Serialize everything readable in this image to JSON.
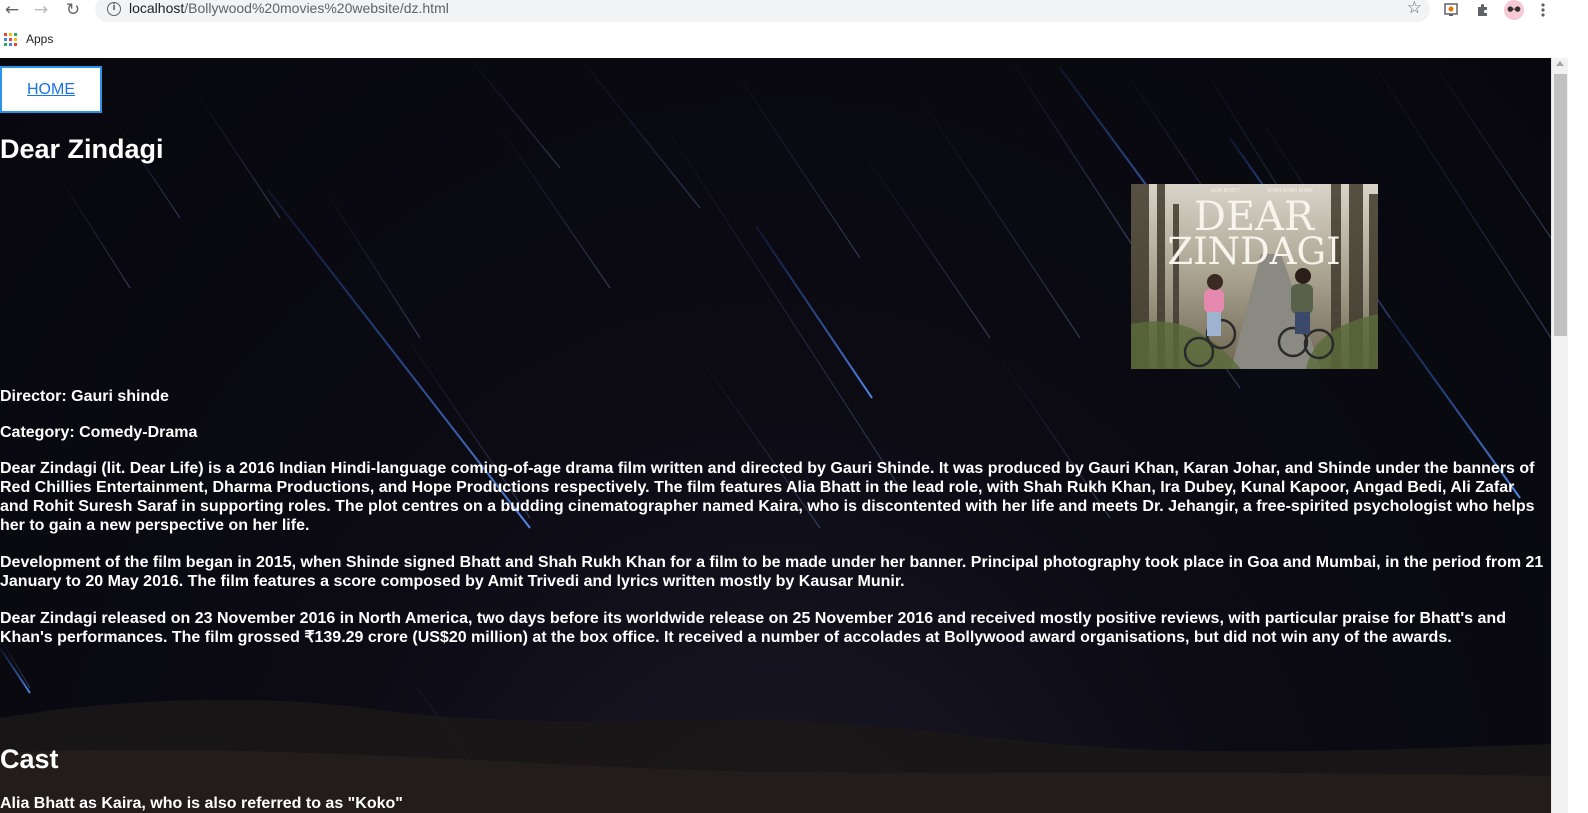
{
  "browser": {
    "url_host": "localhost",
    "url_path": "/Bollywood%20movies%20website/dz.html",
    "bookmarks_apps_label": "Apps",
    "icons": [
      "back-arrow-icon",
      "forward-arrow-icon",
      "reload-icon",
      "info-icon",
      "star-icon",
      "extension-icon",
      "puzzle-icon",
      "profile-avatar-icon",
      "menu-icon",
      "apps-grid-icon"
    ]
  },
  "nav": {
    "home_label": "HOME"
  },
  "movie": {
    "title": "Dear Zindagi",
    "poster": {
      "credit_left": "ALIA BHATT",
      "credit_right": "SHAH RUKH KHAN",
      "title_line1": "DEAR",
      "title_line2": "ZINDAGI"
    },
    "director": "Director: Gauri shinde",
    "category": "Category: Comedy-Drama",
    "paragraphs": [
      "Dear Zindagi (lit. Dear Life) is a 2016 Indian Hindi-language coming-of-age drama film written and directed by Gauri Shinde. It was produced by Gauri Khan, Karan Johar, and Shinde under the banners of Red Chillies Entertainment, Dharma Productions, and Hope Productions respectively. The film features Alia Bhatt in the lead role, with Shah Rukh Khan, Ira Dubey, Kunal Kapoor, Angad Bedi, Ali Zafar and Rohit Suresh Saraf in supporting roles. The plot centres on a budding cinematographer named Kaira, who is discontented with her life and meets Dr. Jehangir, a free-spirited psychologist who helps her to gain a new perspective on her life.",
      "Development of the film began in 2015, when Shinde signed Bhatt and Shah Rukh Khan for a film to be made under her banner. Principal photography took place in Goa and Mumbai, in the period from 21 January to 20 May 2016. The film features a score composed by Amit Trivedi and lyrics written mostly by Kausar Munir.",
      "Dear Zindagi released on 23 November 2016 in North America, two days before its worldwide release on 25 November 2016 and received mostly positive reviews, with particular praise for Bhatt's and Khan's performances. The film grossed ₹139.29 crore (US$20 million) at the box office. It received a number of accolades at Bollywood award organisations, but did not win any of the awards."
    ],
    "cast_heading": "Cast",
    "cast_first": "Alia Bhatt as Kaira, who is also referred to as \"Koko\""
  },
  "colors": {
    "page_background": "#0a0a12",
    "streak_blue": "#3f7df0",
    "home_border": "#2b93e8",
    "link": "#1a73e8",
    "text": "#ffffff"
  }
}
